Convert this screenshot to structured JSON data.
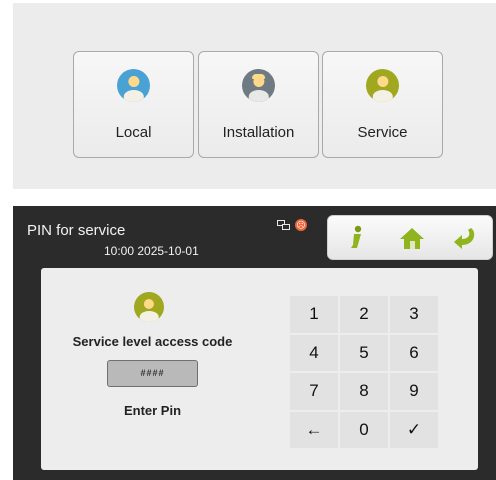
{
  "roles": [
    {
      "label": "Local",
      "avatar_color": "#4aa1d4",
      "body_color": "#f5f0e6",
      "cap": false
    },
    {
      "label": "Installation",
      "avatar_color": "#707a82",
      "body_color": "#e8e8e8",
      "cap": true
    },
    {
      "label": "Service",
      "avatar_color": "#9fa81f",
      "body_color": "#f5f0e6",
      "cap": false
    }
  ],
  "device": {
    "title": "PIN for service",
    "datetime": "10:00  2025-10-01",
    "alarm_glyph": "☹",
    "code_label": "Service level access code",
    "pin_value": "####",
    "enter_label": "Enter Pin",
    "keys": [
      "1",
      "2",
      "3",
      "4",
      "5",
      "6",
      "7",
      "8",
      "9",
      "←",
      "0",
      "✓"
    ]
  }
}
